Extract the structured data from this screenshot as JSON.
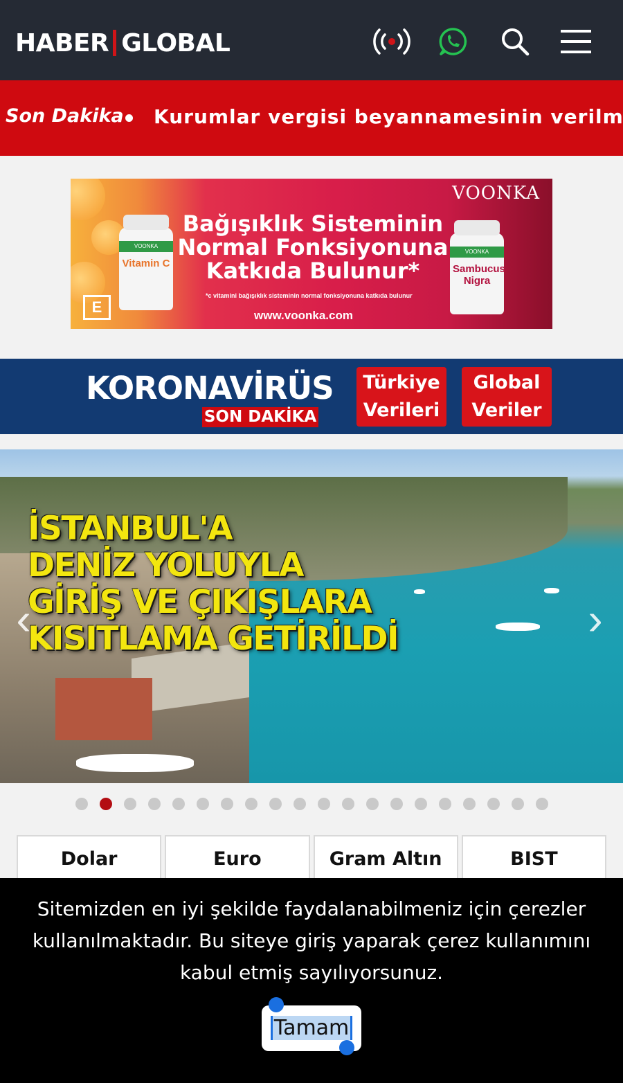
{
  "header": {
    "logo_left": "HABER",
    "logo_right": "GLOBAL",
    "icons": [
      "live-broadcast-icon",
      "whatsapp-icon",
      "search-icon",
      "hamburger-menu-icon"
    ],
    "colors": {
      "background": "#252a34",
      "accent": "#d01418",
      "whatsapp": "#25c251"
    }
  },
  "ticker": {
    "label": "Son Dakika",
    "headline": "Kurumlar vergisi beyannamesinin verilme tarihi"
  },
  "ad": {
    "brand": "VOONKA",
    "headline": "Bağışıklık Sisteminin Normal Fonksiyonuna Katkıda Bulunur*",
    "fine_print": "*c vitamini bağışıklık sisteminin normal fonksiyonuna katkıda bulunur",
    "url": "www.voonka.com",
    "product_left": "Vitamin C",
    "product_right": "Sambucus Nigra"
  },
  "corona": {
    "title": "KORONAVİRÜS",
    "subtitle": "SON DAKİKA",
    "buttons": [
      {
        "line1": "Türkiye",
        "line2": "Verileri"
      },
      {
        "line1": "Global",
        "line2": "Veriler"
      }
    ]
  },
  "hero": {
    "headline_lines": [
      "İSTANBUL'A",
      "DENİZ YOLUYLA",
      "GİRİŞ VE ÇIKIŞLARA",
      "KISITLAMA GETİRİLDİ"
    ],
    "slide_count": 20,
    "active_slide": 2
  },
  "markets": {
    "tabs": [
      "Dolar",
      "Euro",
      "Gram Altın",
      "BIST"
    ]
  },
  "cookie": {
    "message": "Sitemizden en iyi şekilde faydalanabilmeniz için çerezler kullanılmaktadır. Bu siteye giriş yaparak çerez kullanımını kabul etmiş sayılıyorsunuz.",
    "button": "Tamam"
  }
}
